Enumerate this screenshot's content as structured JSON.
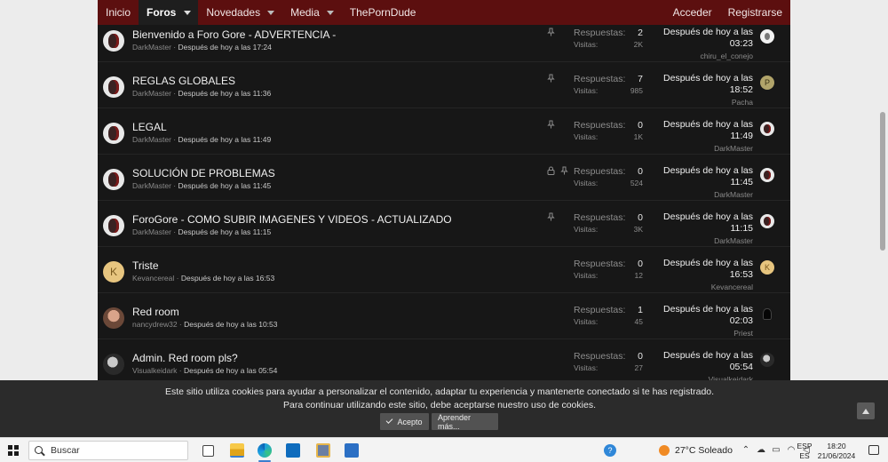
{
  "nav": {
    "items": [
      {
        "label": "Inicio",
        "active": false,
        "caret": false
      },
      {
        "label": "Foros",
        "active": true,
        "caret": true
      },
      {
        "label": "Novedades",
        "active": false,
        "caret": true
      },
      {
        "label": "Media",
        "active": false,
        "caret": true
      },
      {
        "label": "ThePornDude",
        "active": false,
        "caret": false
      }
    ],
    "login": "Acceder",
    "register": "Registrarse"
  },
  "labels": {
    "replies": "Respuestas:",
    "views": "Visitas:"
  },
  "threads": [
    {
      "title": "Bienvenido a Foro Gore - ADVERTENCIA -",
      "author": "DarkMaster",
      "date": "Después de hoy a las 17:24",
      "pinned": true,
      "locked": false,
      "replies": "2",
      "views": "2K",
      "last_date": "Después de hoy a las 03:23",
      "last_user": "chiru_el_conejo",
      "avatar": "gore",
      "last_avatar": "white"
    },
    {
      "title": "REGLAS GLOBALES",
      "author": "DarkMaster",
      "date": "Después de hoy a las 11:36",
      "pinned": true,
      "locked": false,
      "replies": "7",
      "views": "985",
      "last_date": "Después de hoy a las 18:52",
      "last_user": "Pacha",
      "avatar": "gore",
      "last_avatar": "P"
    },
    {
      "title": "LEGAL",
      "author": "DarkMaster",
      "date": "Después de hoy a las 11:49",
      "pinned": true,
      "locked": false,
      "replies": "0",
      "views": "1K",
      "last_date": "Después de hoy a las 11:49",
      "last_user": "DarkMaster",
      "avatar": "gore",
      "last_avatar": "gore"
    },
    {
      "title": "SOLUCIÓN DE PROBLEMAS",
      "author": "DarkMaster",
      "date": "Después de hoy a las 11:45",
      "pinned": true,
      "locked": true,
      "replies": "0",
      "views": "524",
      "last_date": "Después de hoy a las 11:45",
      "last_user": "DarkMaster",
      "avatar": "gore",
      "last_avatar": "gore"
    },
    {
      "title": "ForoGore - COMO SUBIR IMAGENES Y VIDEOS - ACTUALIZADO",
      "author": "DarkMaster",
      "date": "Después de hoy a las 11:15",
      "pinned": true,
      "locked": false,
      "replies": "0",
      "views": "3K",
      "last_date": "Después de hoy a las 11:15",
      "last_user": "DarkMaster",
      "avatar": "gore",
      "last_avatar": "gore"
    },
    {
      "title": "Triste",
      "author": "Kevancereal",
      "date": "Después de hoy a las 16:53",
      "pinned": false,
      "locked": false,
      "replies": "0",
      "views": "12",
      "last_date": "Después de hoy a las 16:53",
      "last_user": "Kevancereal",
      "avatar": "K",
      "last_avatar": "K"
    },
    {
      "title": "Red room",
      "author": "nancydrew32",
      "date": "Después de hoy a las 10:53",
      "pinned": false,
      "locked": false,
      "replies": "1",
      "views": "45",
      "last_date": "Después de hoy a las 02:03",
      "last_user": "Priest",
      "avatar": "photo1",
      "last_avatar": "dark"
    },
    {
      "title": "Admin. Red room pls?",
      "author": "Visualkeidark",
      "date": "Después de hoy a las 05:54",
      "pinned": false,
      "locked": false,
      "replies": "0",
      "views": "27",
      "last_date": "Después de hoy a las 05:54",
      "last_user": "Visualkeidark",
      "avatar": "photo2",
      "last_avatar": "photo"
    }
  ],
  "cookie": {
    "line1": "Este sitio utiliza cookies para ayudar a personalizar el contenido, adaptar tu experiencia y mantenerte conectado si te has registrado.",
    "line2": "Para continuar utilizando este sitio, debe aceptarse nuestro uso de cookies.",
    "accept": "Acepto",
    "more": "Aprender más..."
  },
  "taskbar": {
    "search": "Buscar",
    "weather": "27°C  Soleado",
    "lang1": "ESP",
    "lang2": "ES",
    "time": "18:20",
    "date": "21/06/2024",
    "help_glyph": "?"
  },
  "icons": {
    "pin": "pin-icon",
    "lock": "lock-icon"
  }
}
